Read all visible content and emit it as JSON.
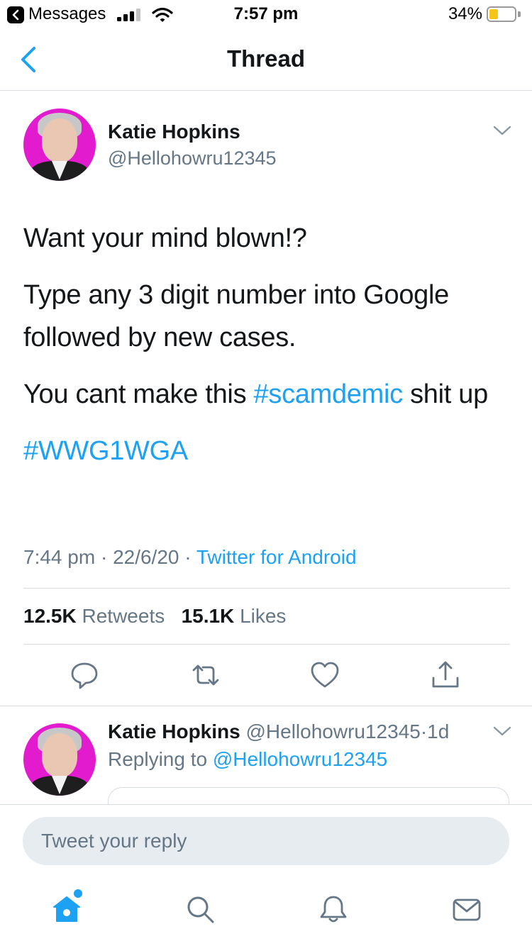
{
  "status_bar": {
    "back_app": "Messages",
    "time": "7:57 pm",
    "battery_percent": "34%",
    "battery_level": 0.34,
    "battery_color": "#f5c518"
  },
  "nav": {
    "title": "Thread",
    "back_icon": "chevron-left-icon"
  },
  "tweet": {
    "author_name": "Katie Hopkins",
    "author_handle": "@Hellohowru12345",
    "paragraph1": "Want your mind blown!?",
    "paragraph2": "Type any 3 digit number into Google followed by new cases.",
    "paragraph3_before": "You cant make this ",
    "hashtag1": "#scamdemic",
    "paragraph3_after": " shit up",
    "hashtag2": "#WWG1WGA",
    "time": "7:44 pm",
    "date": "22/6/20",
    "sep": "·",
    "source": "Twitter for Android",
    "retweets_count": "12.5K",
    "retweets_label": "Retweets",
    "likes_count": "15.1K",
    "likes_label": "Likes"
  },
  "actions": [
    "reply-icon",
    "retweet-icon",
    "like-icon",
    "share-icon"
  ],
  "reply": {
    "author_name": "Katie Hopkins",
    "author_handle": "@Hellohowru12345",
    "age": "1d",
    "sep": "·",
    "replying_label": "Replying to",
    "replying_handle": "@Hellohowru12345"
  },
  "composer": {
    "placeholder": "Tweet your reply"
  },
  "tab_bar": [
    "home-icon",
    "search-icon",
    "notifications-icon",
    "messages-icon"
  ],
  "colors": {
    "accent": "#1da1f2",
    "secondary_text": "#657786",
    "primary_text": "#14171a",
    "avatar_bg": "#e21bcf"
  }
}
